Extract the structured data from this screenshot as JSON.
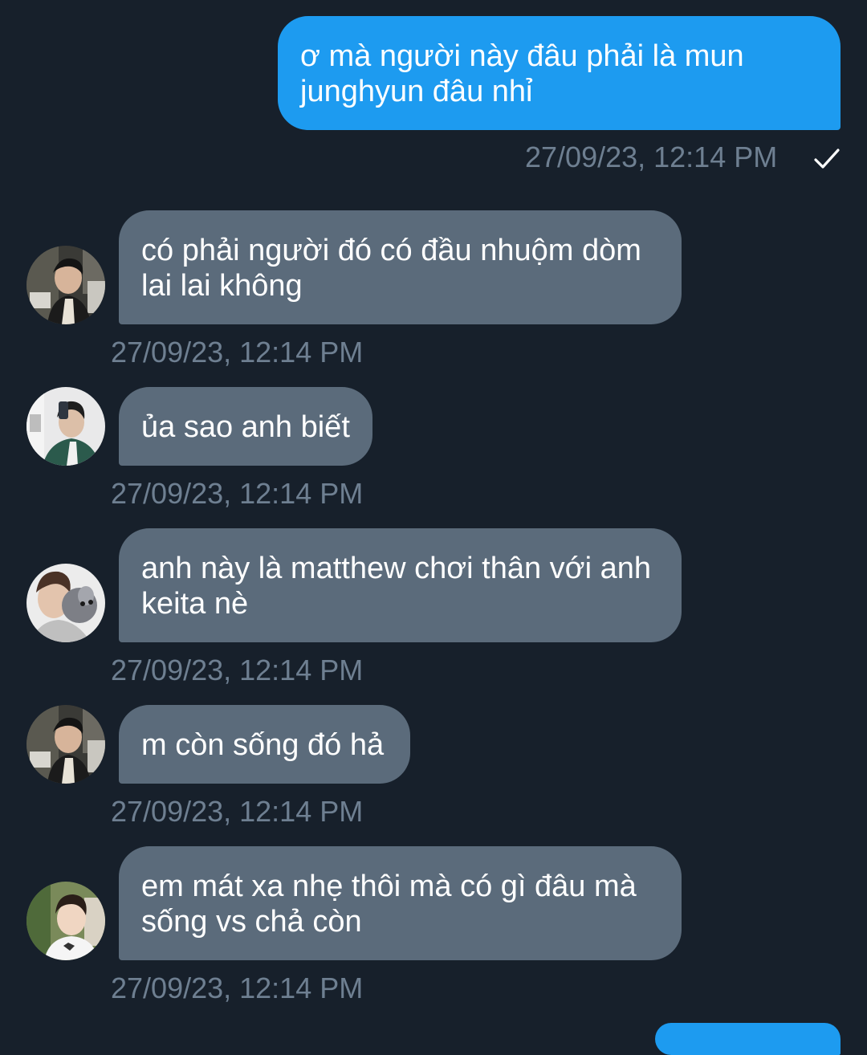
{
  "colors": {
    "background": "#17202b",
    "outgoing_bubble": "#1d9bf0",
    "incoming_bubble": "#5b6b7b",
    "timestamp": "#6e7f91"
  },
  "messages": [
    {
      "direction": "outgoing",
      "text": "ơ mà người này đâu phải là mun\njunghyun đâu nhỉ",
      "timestamp": "27/09/23, 12:14 PM",
      "status_icon": "checkmark-icon"
    },
    {
      "direction": "incoming",
      "text": "có phải người đó có đầu nhuộm dòm\nlai lai không",
      "timestamp": "27/09/23, 12:14 PM",
      "avatar": "avatar-1"
    },
    {
      "direction": "incoming",
      "text": "ủa sao anh biết",
      "timestamp": "27/09/23, 12:14 PM",
      "avatar": "avatar-2"
    },
    {
      "direction": "incoming",
      "text": "anh này là matthew chơi thân với anh\nkeita nè",
      "timestamp": "27/09/23, 12:14 PM",
      "avatar": "avatar-3"
    },
    {
      "direction": "incoming",
      "text": "m còn sống đó hả",
      "timestamp": "27/09/23, 12:14 PM",
      "avatar": "avatar-1"
    },
    {
      "direction": "incoming",
      "text": "em mát xa nhẹ thôi mà có gì đâu mà\nsống vs chả còn",
      "timestamp": "27/09/23, 12:14 PM",
      "avatar": "avatar-4"
    }
  ]
}
